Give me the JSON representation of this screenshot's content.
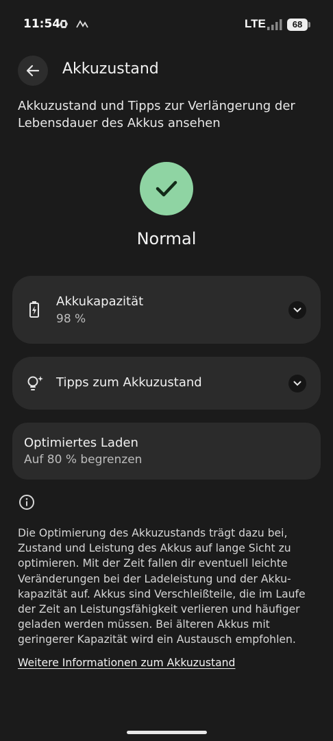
{
  "status_bar": {
    "time": "11:54",
    "network": "LTE",
    "battery_level": "68",
    "icons": [
      "drive-icon",
      "signal-wave-icon",
      "cell-signal-icon",
      "battery-icon"
    ]
  },
  "header": {
    "title": "Akkuzustand",
    "back_icon": "arrow-left-icon"
  },
  "intro": "Akkuzustand und Tipps zur Verlängerung der Lebensdauer des Akkus ansehen",
  "status": {
    "label": "Normal",
    "icon": "checkmark-icon",
    "color": "#8fd4a3"
  },
  "cards": {
    "capacity": {
      "title": "Akkukapazität",
      "value": "98 %",
      "icon": "battery-charging-icon"
    },
    "tips": {
      "title": "Tipps zum Akkuzustand",
      "icon": "lightbulb-sparkle-icon"
    },
    "optimized": {
      "title": "Optimiertes Laden",
      "subtitle": "Auf 80 % begrenzen"
    }
  },
  "footer": {
    "info_icon": "info-icon",
    "text": "Die Optimierung des Akkuzustands trägt dazu bei, Zustand und Leistung des Akkus auf lange Sicht zu optimieren. Mit der Zeit fallen dir eventuell leichte Veränderungen bei der Ladeleistung und der Akku­kapazität auf. Akkus sind Verschleißteile, die im Laufe der Zeit an Leistungsfähigkeit verlieren und häufiger geladen werden müssen. Bei älteren Akkus mit geringerer Kapazität wird ein Austausch empfohlen.",
    "link": "Weitere Informationen zum Akkuzustand"
  }
}
